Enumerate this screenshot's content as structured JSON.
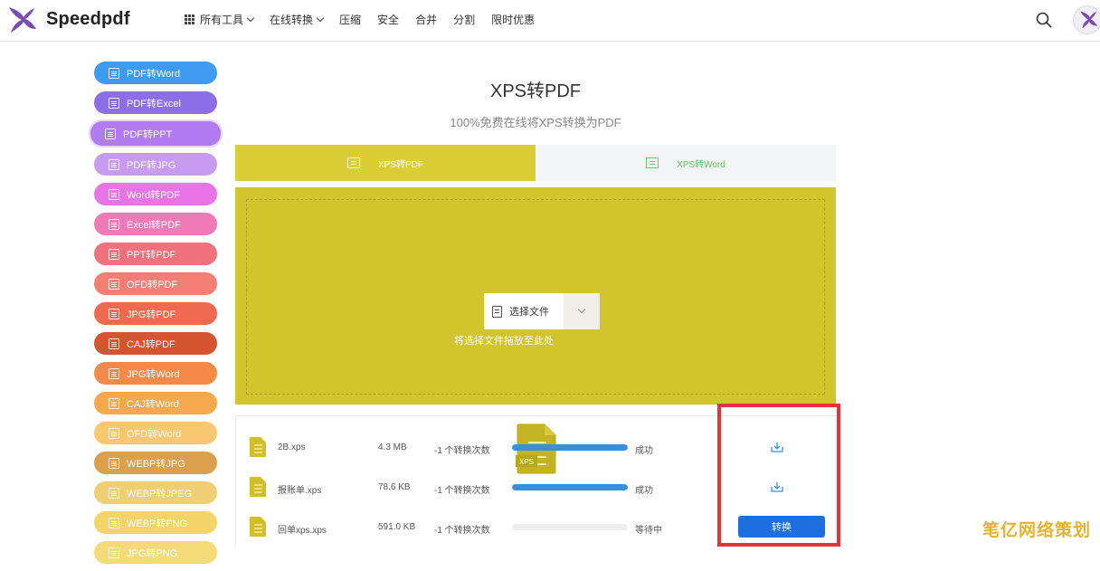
{
  "header": {
    "brand": "Speedpdf",
    "nav": [
      {
        "label": "所有工具",
        "icon": "grid-icon",
        "dropdown": true
      },
      {
        "label": "在线转换",
        "dropdown": true
      },
      {
        "label": "压缩"
      },
      {
        "label": "安全"
      },
      {
        "label": "合并"
      },
      {
        "label": "分割"
      },
      {
        "label": "限时优惠"
      }
    ]
  },
  "sidebar": {
    "items": [
      {
        "label": "PDF转Word",
        "color": "#3f9bf0"
      },
      {
        "label": "PDF转Excel",
        "color": "#8c6fe6"
      },
      {
        "label": "PDF转PPT",
        "color": "#b07cf0",
        "active": true
      },
      {
        "label": "PDF转JPG",
        "color": "#c69bf0"
      },
      {
        "label": "Word转PDF",
        "color": "#e874e6"
      },
      {
        "label": "Excel转PDF",
        "color": "#f07ab8"
      },
      {
        "label": "PPT转PDF",
        "color": "#f0727c"
      },
      {
        "label": "OFD转PDF",
        "color": "#f27f74"
      },
      {
        "label": "JPG转PDF",
        "color": "#f06a52"
      },
      {
        "label": "CAJ转PDF",
        "color": "#d55530"
      },
      {
        "label": "JPG转Word",
        "color": "#f48a4a"
      },
      {
        "label": "CAJ转Word",
        "color": "#f5a84c"
      },
      {
        "label": "OFD转Word",
        "color": "#f7c870"
      },
      {
        "label": "WEBP转JPG",
        "color": "#dca04c"
      },
      {
        "label": "WEBP转JPEG",
        "color": "#f0ce74"
      },
      {
        "label": "WEBP转PNG",
        "color": "#f3d468"
      },
      {
        "label": "JPG转PNG",
        "color": "#f4db78"
      }
    ]
  },
  "main": {
    "title": "XPS转PDF",
    "subtitle": "100%免费在线将XPS转换为PDF",
    "tabs": [
      {
        "label": "XPS转PDF",
        "active": true
      },
      {
        "label": "XPS转Word",
        "active": false
      }
    ],
    "upload": {
      "file_badge": "XPS",
      "choose_label": "选择文件",
      "drop_hint": "将选择文件拖放至此处"
    },
    "files": [
      {
        "name": "2B.xps",
        "size": "4.3 MB",
        "conversions": "-1 个转换次数",
        "progress": 1.0,
        "status": "成功",
        "action": "download"
      },
      {
        "name": "报账单.xps",
        "size": "78.6 KB",
        "conversions": "-1 个转换次数",
        "progress": 1.0,
        "status": "成功",
        "action": "download"
      },
      {
        "name": "回单xps.xps",
        "size": "591.0 KB",
        "conversions": "-1 个转换次数",
        "progress": 0.0,
        "status": "等待中",
        "action": "convert",
        "action_label": "转换"
      }
    ]
  },
  "watermark": "笔亿网络策划",
  "colors": {
    "accent_yellow": "#dbcd35",
    "upload_bg": "#d2c42d",
    "progress_blue": "#3a8fd9",
    "convert_blue": "#1d6fe0",
    "highlight_red": "#e2353b"
  }
}
